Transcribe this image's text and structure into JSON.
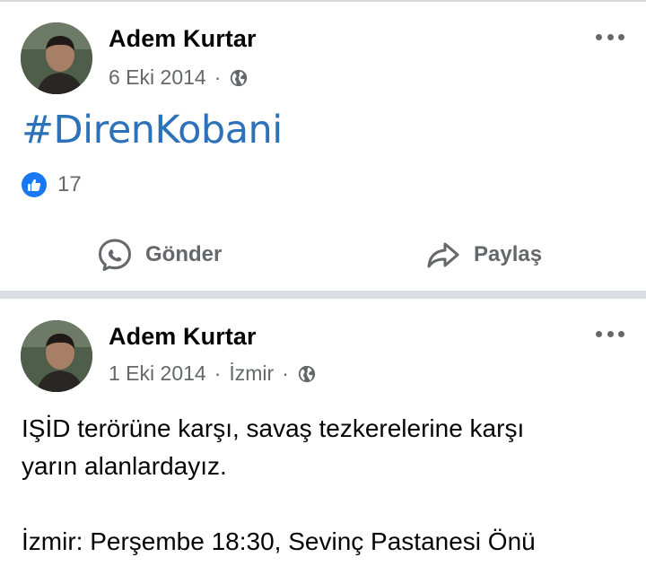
{
  "posts": [
    {
      "author": "Adem Kurtar",
      "date": "6 Eki 2014",
      "separator": "·",
      "hashtag": "#DirenKobani",
      "likes": "17",
      "actions": {
        "send": "Gönder",
        "share": "Paylaş"
      }
    },
    {
      "author": "Adem Kurtar",
      "date": "1 Eki 2014",
      "separator": "·",
      "location": "İzmir",
      "text_line1": "IŞİD terörüne karşı, savaş tezkerelerine karşı",
      "text_line2": "yarın alanlardayız.",
      "text_line3": "İzmir: Perşembe 18:30, Sevinç Pastanesi Önü"
    }
  ],
  "colors": {
    "link": "#2d71b8",
    "secondary_text": "#65676b",
    "like_blue": "#1877f2",
    "divider": "#dadde1"
  },
  "icons": [
    "globe-icon",
    "more-options-icon",
    "like-icon",
    "messenger-icon",
    "share-arrow-icon"
  ]
}
